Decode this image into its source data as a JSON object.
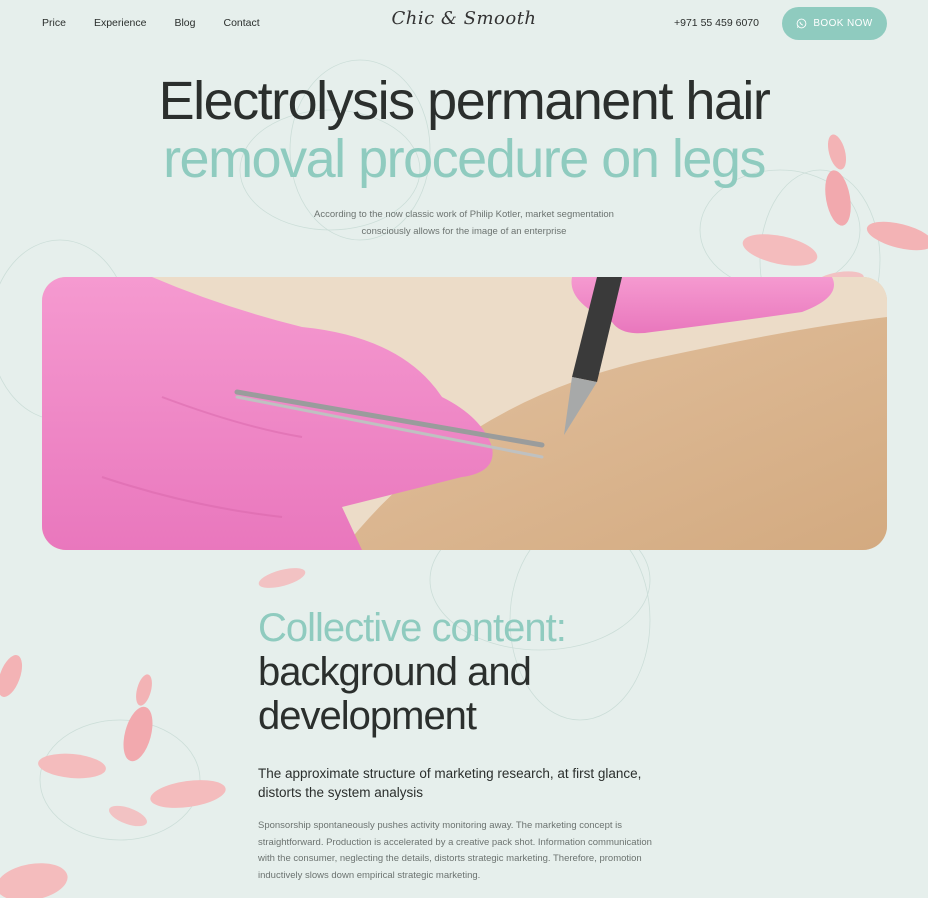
{
  "nav": {
    "links": [
      "Price",
      "Experience",
      "Blog",
      "Contact"
    ],
    "logo": "Chic & Smooth",
    "phone": "+971 55 459 6070",
    "book_label": "BOOK NOW"
  },
  "hero": {
    "title_line1": "Electrolysis permanent hair",
    "title_line2": "removal procedure on legs",
    "subtitle": "According to the now classic work of Philip Kotler, market segmentation consciously allows for the image of an enterprise"
  },
  "section": {
    "title_accent": "Collective content:",
    "title_line2": "background and",
    "title_line3": "development",
    "lead": "The approximate structure of marketing research, at first glance, distorts the system analysis",
    "body": "Sponsorship spontaneously pushes activity monitoring away. The marketing concept is straightforward. Production is accelerated by a creative pack shot. Information communication with the consumer, neglecting the details, distorts strategic marketing. Therefore, promotion inductively slows down empirical strategic marketing."
  },
  "colors": {
    "background": "#e6efec",
    "accent": "#8fcbbf",
    "text": "#2b2f2d",
    "glove": "#f089c6",
    "petal": "#f3b3b5"
  },
  "icons": {
    "book_button": "whatsapp-icon"
  }
}
